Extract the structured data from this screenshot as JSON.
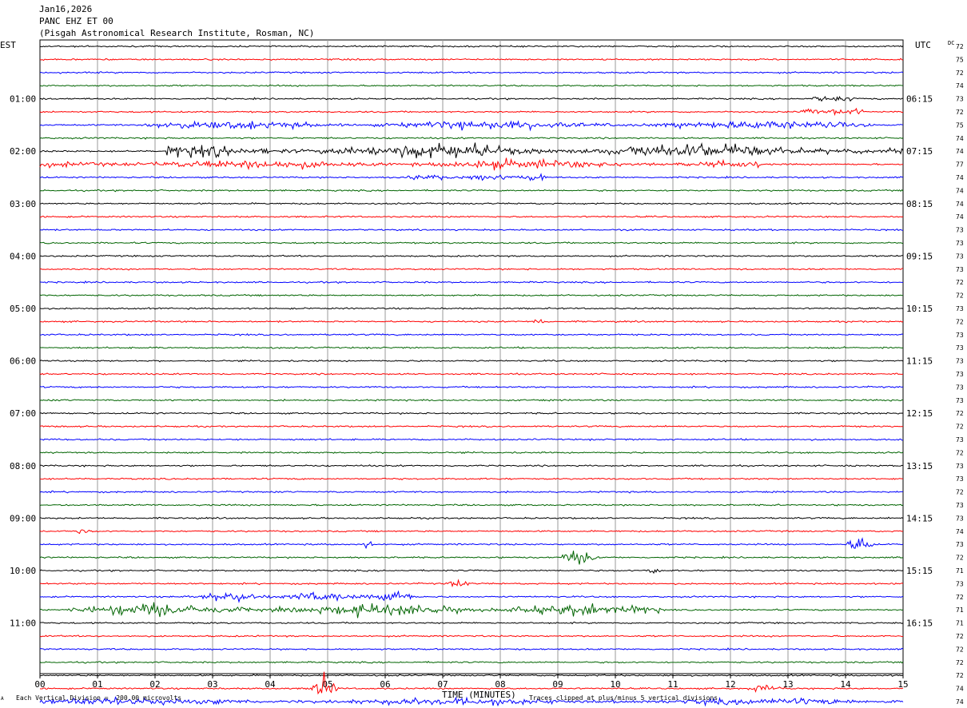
{
  "header": {
    "date": "Jan16,2026",
    "station": "PANC EHZ ET 00",
    "location": "(Pisgah Astronomical Research Institute, Rosman, NC)"
  },
  "left_axis_title": "EST",
  "right_axis_title": "UTC",
  "dc_header": "DC",
  "footer": {
    "scale_note": "Each Vertical Division =  200.00 microvolts",
    "clip_note": "Traces clipped at plus/minus 5 vertical divisions",
    "corner_mark": "A"
  },
  "colors": {
    "black": "#000000",
    "red": "#ff0000",
    "blue": "#0000ff",
    "green": "#006400",
    "grid": "#9a9a9a"
  },
  "chart_data": {
    "type": "line",
    "subtype": "helicorder",
    "xlabel": "TIME (MINUTES)",
    "xlim": [
      0,
      15
    ],
    "x_ticks": [
      "00",
      "01",
      "02",
      "03",
      "04",
      "05",
      "06",
      "07",
      "08",
      "09",
      "10",
      "11",
      "12",
      "13",
      "14",
      "15"
    ],
    "minutes_per_line": 15,
    "color_cycle": [
      "black",
      "red",
      "blue",
      "green"
    ],
    "left_hour_labels": [
      "01:00",
      "02:00",
      "03:00",
      "04:00",
      "05:00",
      "06:00",
      "07:00",
      "08:00",
      "09:00",
      "10:00",
      "11:00"
    ],
    "right_hour_labels": [
      "06:15",
      "07:15",
      "08:15",
      "09:15",
      "10:15",
      "11:15",
      "12:15",
      "13:15",
      "14:15",
      "15:15",
      "16:15"
    ],
    "dc_offsets": [
      "72",
      "75",
      "72",
      "74",
      "73",
      "72",
      "75",
      "74",
      "74",
      "77",
      "74",
      "74",
      "74",
      "74",
      "73",
      "73",
      "73",
      "73",
      "72",
      "72",
      "73",
      "72",
      "73",
      "73",
      "73",
      "73",
      "73",
      "73",
      "72",
      "72",
      "73",
      "72",
      "73",
      "73",
      "72",
      "73",
      "73",
      "74",
      "73",
      "72",
      "71",
      "73",
      "72",
      "71",
      "71",
      "72",
      "72",
      "72",
      "72",
      "74",
      "74"
    ],
    "events": [
      {
        "line": 4,
        "start_min": 13.4,
        "end_min": 14.2,
        "level": 0.5
      },
      {
        "line": 5,
        "start_min": 13.2,
        "end_min": 14.3,
        "level": 0.45
      },
      {
        "line": 6,
        "start_min": 1.8,
        "end_min": 14.5,
        "level": 0.55
      },
      {
        "line": 8,
        "start_min": 2.2,
        "end_min": 15.0,
        "level": 1.0
      },
      {
        "line": 9,
        "start_min": 0.0,
        "end_min": 12.5,
        "level": 0.6
      },
      {
        "line": 10,
        "start_min": 6.0,
        "end_min": 8.8,
        "level": 0.5
      },
      {
        "line": 21,
        "start_min": 8.5,
        "end_min": 8.8,
        "level": 0.6
      },
      {
        "line": 37,
        "start_min": 0.6,
        "end_min": 0.9,
        "level": 0.4
      },
      {
        "line": 38,
        "start_min": 5.6,
        "end_min": 5.8,
        "level": 1.0
      },
      {
        "line": 38,
        "start_min": 14.0,
        "end_min": 14.5,
        "level": 1.2
      },
      {
        "line": 39,
        "start_min": 9.0,
        "end_min": 9.8,
        "level": 0.8
      },
      {
        "line": 40,
        "start_min": 10.5,
        "end_min": 10.8,
        "level": 0.5
      },
      {
        "line": 41,
        "start_min": 7.0,
        "end_min": 7.5,
        "level": 0.45
      },
      {
        "line": 42,
        "start_min": 2.5,
        "end_min": 6.5,
        "level": 0.7
      },
      {
        "line": 43,
        "start_min": 0.5,
        "end_min": 10.8,
        "level": 0.8
      },
      {
        "line": 49,
        "start_min": 4.7,
        "end_min": 5.2,
        "level": 1.6
      },
      {
        "line": 49,
        "start_min": 12.3,
        "end_min": 12.9,
        "level": 0.6
      },
      {
        "line": 50,
        "start_min": 0.0,
        "end_min": 15.0,
        "level": 0.45
      }
    ]
  }
}
